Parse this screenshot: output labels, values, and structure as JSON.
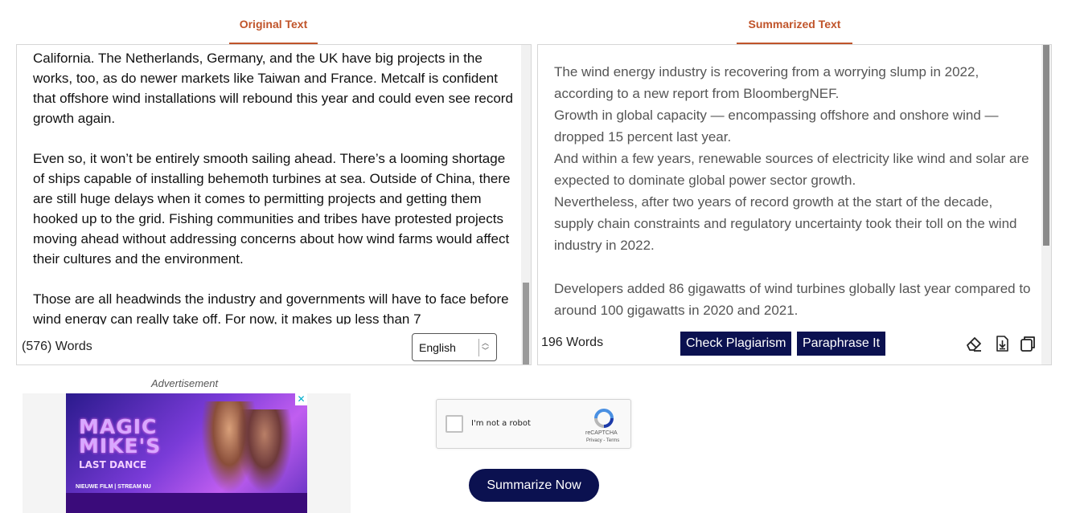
{
  "tabs": {
    "original": "Original Text",
    "summary": "Summarized Text"
  },
  "original_panel": {
    "paragraphs": [
      "California. The Netherlands, Germany, and the UK have big projects in the works, too, as do newer markets like Taiwan and France. Metcalf is confident that offshore wind installations will rebound this year and could even see record growth again.",
      "Even so, it won’t be entirely smooth sailing ahead. There’s a looming shortage of ships capable of installing behemoth turbines at sea. Outside of China, there are still huge delays when it comes to permitting projects and getting them hooked up to the grid. Fishing communities and tribes have protested projects moving ahead without addressing concerns about how wind farms would affect their cultures and the environment.",
      "Those are all headwinds the industry and governments will have to face before wind energy can really take off. For now, it makes up less than 7"
    ],
    "word_count": "(576) Words",
    "language": "English"
  },
  "summary_panel": {
    "paragraphs": [
      "The wind energy industry is recovering from a worrying slump in 2022, according to a new report from BloombergNEF.",
      "Growth in global capacity — encompassing offshore and onshore wind — dropped 15 percent last year.",
      "And within a few years, renewable sources of electricity like wind and solar are expected to dominate global power sector growth.",
      "Nevertheless, after two years of record growth at the start of the decade, supply chain constraints and regulatory uncertainty took their toll on the wind industry in 2022.",
      "Developers added 86 gigawatts of wind turbines globally last year compared to around 100 gigawatts in 2020 and 2021."
    ],
    "word_count": "196 Words",
    "check_plagiarism": "Check Plagiarism",
    "paraphrase": "Paraphrase It"
  },
  "advertisement": {
    "label": "Advertisement",
    "title": "MAGIC MIKE'S",
    "subtitle": "LAST DANCE",
    "tagline": "NIEUWE FILM | STREAM NU",
    "close": "✕"
  },
  "captcha": {
    "label": "I'm not a robot",
    "brand": "reCAPTCHA",
    "terms": "Privacy - Terms"
  },
  "summarize_button": "Summarize Now",
  "colors": {
    "accent": "#c0542a",
    "button_dark": "#0b1150"
  }
}
